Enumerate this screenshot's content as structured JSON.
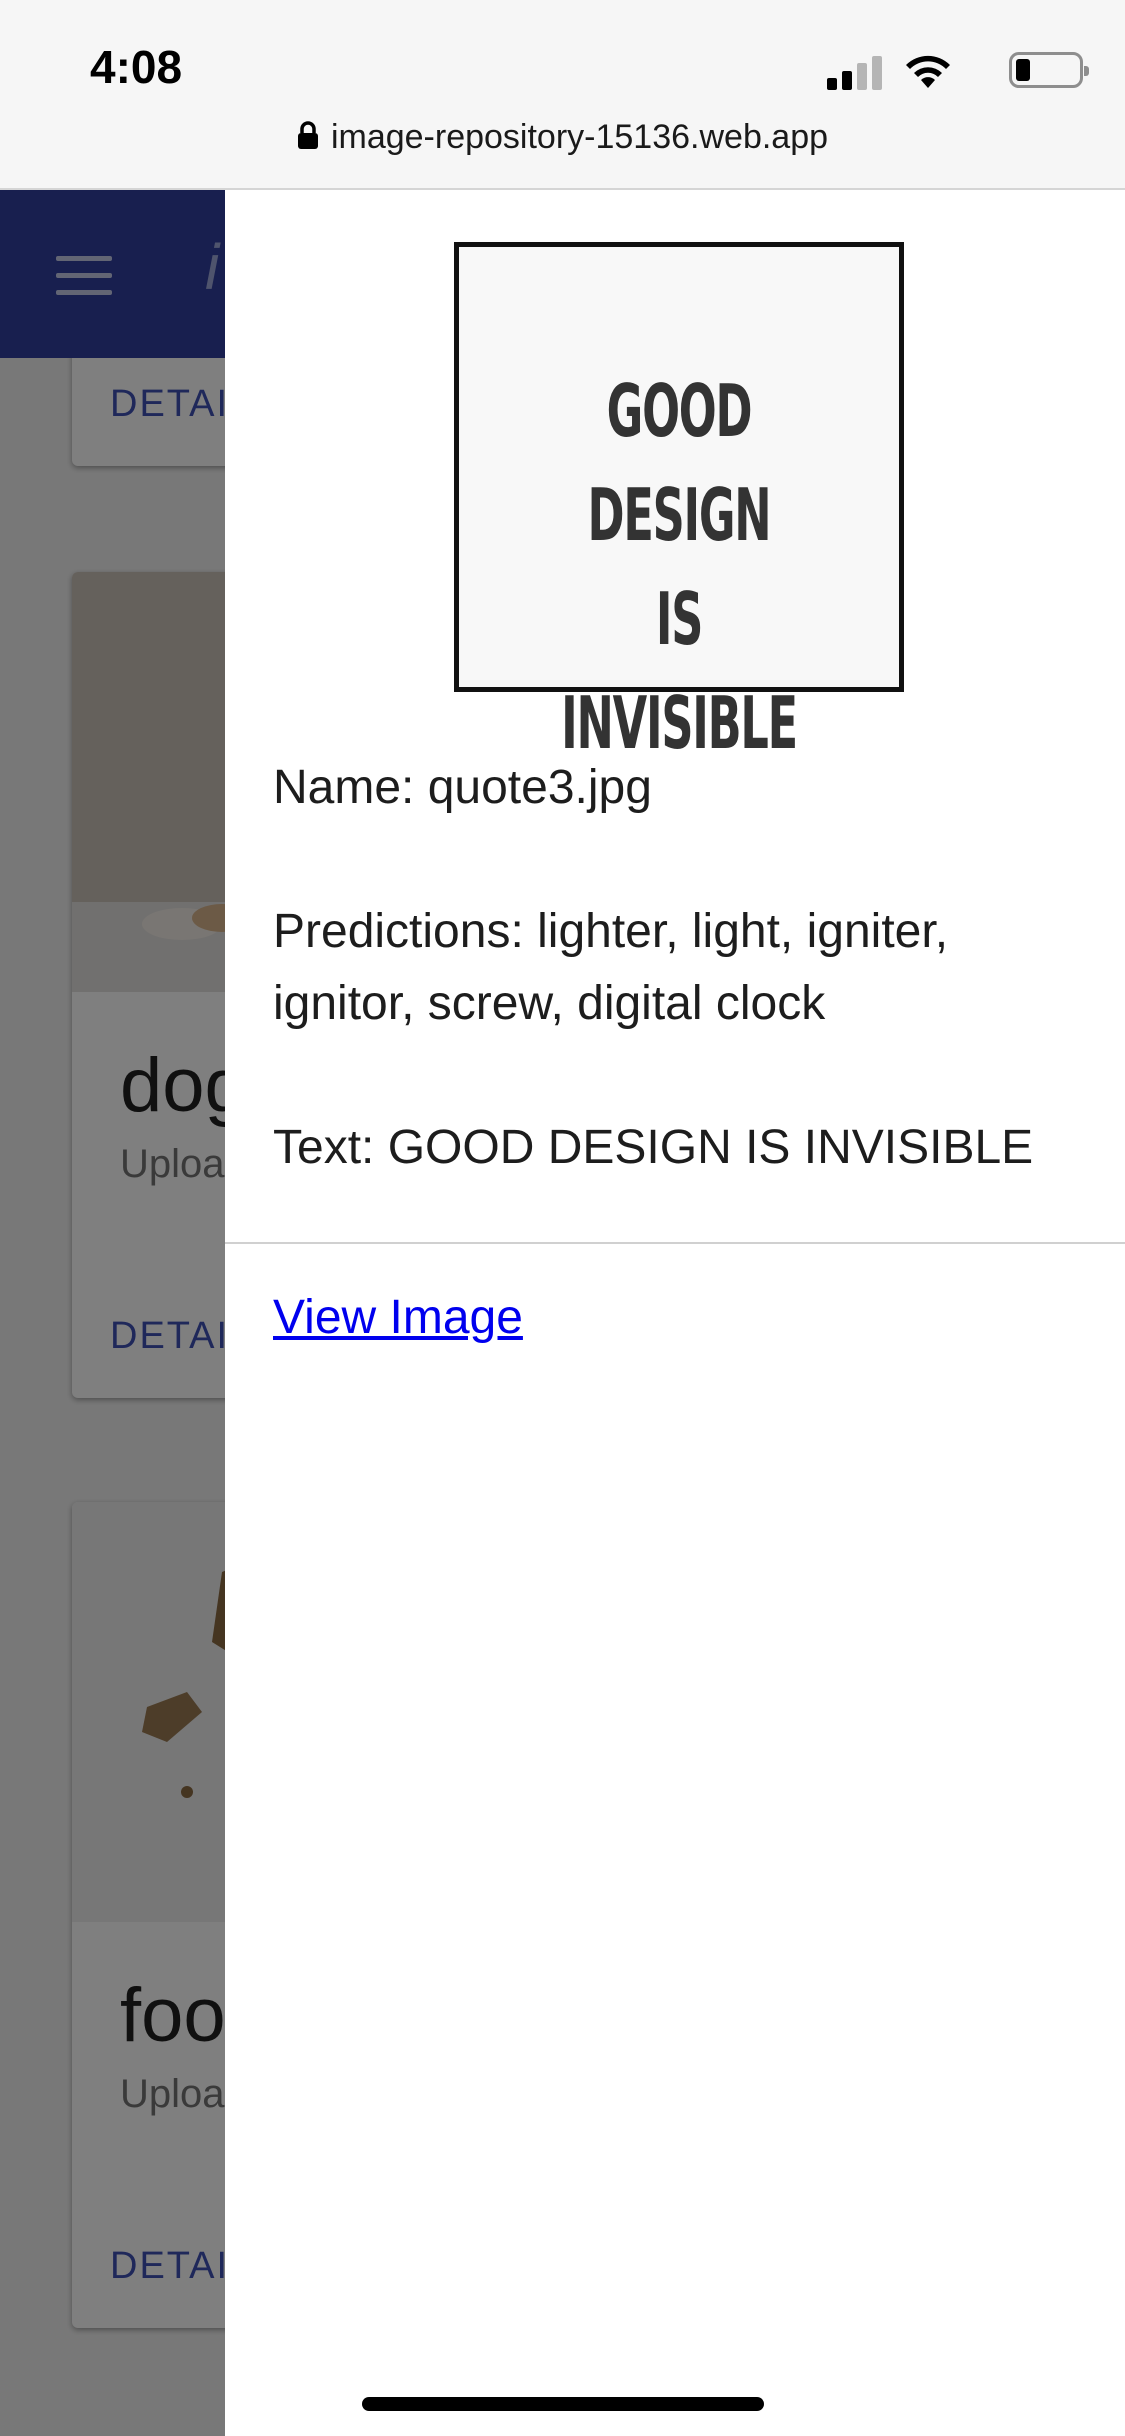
{
  "status_bar": {
    "time": "4:08"
  },
  "browser": {
    "url": "image-repository-15136.web.app"
  },
  "app": {
    "title": "i"
  },
  "cards": [
    {
      "title": "",
      "subtitle": "",
      "action": "DETAI"
    },
    {
      "title": "dog",
      "subtitle": "Uploa",
      "action": "DETAI"
    },
    {
      "title": "food",
      "subtitle": "Uploa",
      "action": "DETAI"
    }
  ],
  "drawer": {
    "preview_text_line1": "GOOD DESIGN",
    "preview_text_line2": "IS INVISIBLE",
    "name": "Name: quote3.jpg",
    "predictions": "Predictions: lighter, light, igniter, ignitor, screw, digital clock",
    "text": "Text: GOOD DESIGN IS INVISIBLE",
    "view_link": "View Image"
  },
  "colors": {
    "app_bar": "#303f9f",
    "link": "#0000ee",
    "card_action": "#3f51b5"
  }
}
